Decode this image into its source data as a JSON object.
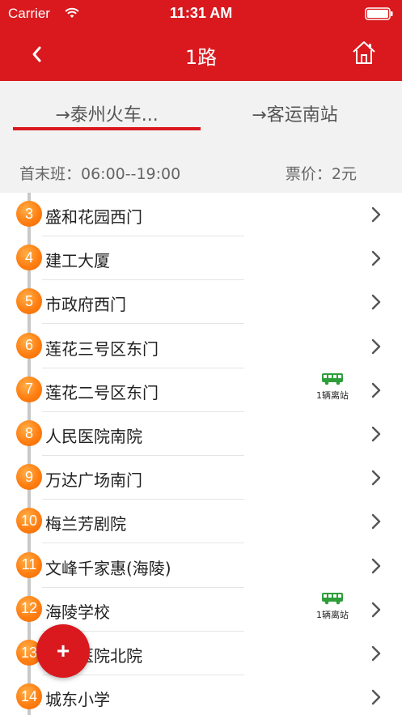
{
  "status_bar": {
    "carrier": "Carrier",
    "time": "11:31 AM"
  },
  "nav": {
    "title": "1路",
    "back_icon": "chevron-left-icon",
    "home_icon": "home-icon"
  },
  "tabs": [
    {
      "label": "→泰州火车...",
      "selected": true
    },
    {
      "label": "→客运南站",
      "selected": false
    }
  ],
  "info": {
    "schedule": "首末班：06:00--19:00",
    "fare": "票价：2元"
  },
  "stops": [
    {
      "number": "3",
      "name": "盛和花园西门",
      "bus": ""
    },
    {
      "number": "4",
      "name": "建工大厦",
      "bus": ""
    },
    {
      "number": "5",
      "name": "市政府西门",
      "bus": ""
    },
    {
      "number": "6",
      "name": "莲花三号区东门",
      "bus": ""
    },
    {
      "number": "7",
      "name": "莲花二号区东门",
      "bus": "1辆离站"
    },
    {
      "number": "8",
      "name": "人民医院南院",
      "bus": ""
    },
    {
      "number": "9",
      "name": "万达广场南门",
      "bus": ""
    },
    {
      "number": "10",
      "name": "梅兰芳剧院",
      "bus": ""
    },
    {
      "number": "11",
      "name": "文峰千家惠(海陵)",
      "bus": ""
    },
    {
      "number": "12",
      "name": "海陵学校",
      "bus": "1辆离站"
    },
    {
      "number": "13",
      "name": "人民医院北院",
      "bus": ""
    },
    {
      "number": "14",
      "name": "城东小学",
      "bus": ""
    }
  ],
  "fab": {
    "label": "+"
  },
  "colors": {
    "accent": "#d9191e",
    "badge": "#ff7e12",
    "bus": "#2e9e3a"
  }
}
